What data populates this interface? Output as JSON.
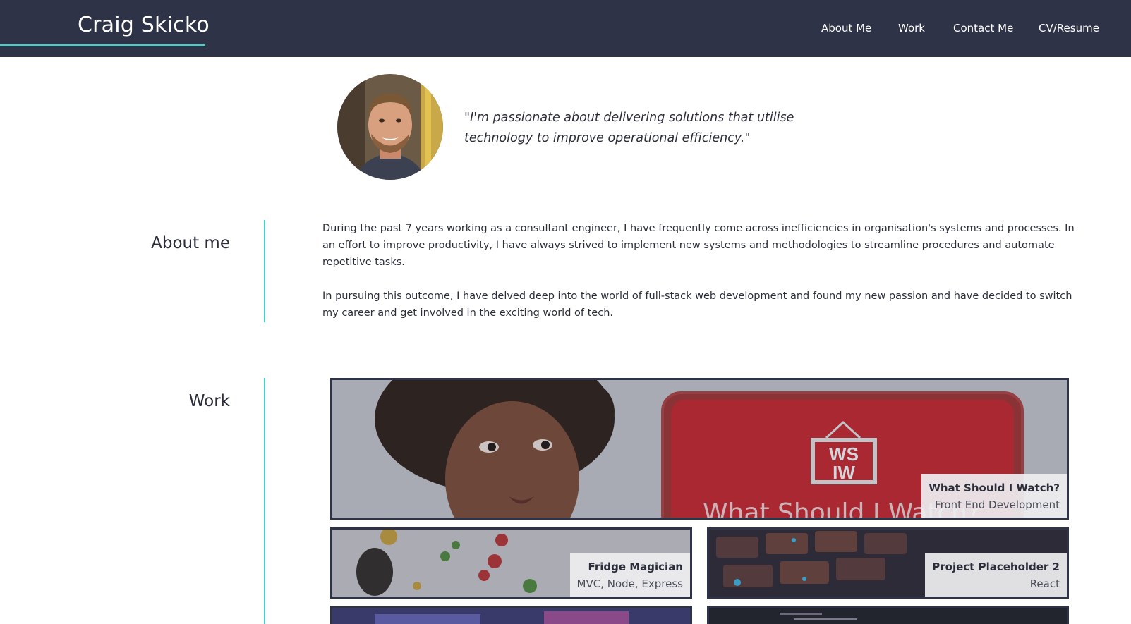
{
  "site": {
    "brand": "Craig Skicko"
  },
  "nav": {
    "items": [
      "About Me",
      "Work",
      "Contact Me",
      "CV/Resume"
    ]
  },
  "hero": {
    "quote": "\"I'm passionate about delivering solutions that utilise technology to improve operational efficiency.\""
  },
  "about": {
    "title": "About me",
    "paragraphs": [
      "During the past 7 years working as a consultant engineer, I have frequently come across inefficiencies in organisation's systems and processes. In an effort to improve productivity, I have always strived to implement new systems and methodologies to streamline procedures and automate repetitive tasks.",
      "In pursuing this outcome, I have delved deep into the world of full-stack web development and found my new passion and have decided to switch my career and get involved in the exciting world of tech."
    ]
  },
  "work": {
    "title": "Work",
    "projects": [
      {
        "title": "What Should I Watch?",
        "subtitle": "Front End Development",
        "logo_top": "WS",
        "logo_bottom": "IW",
        "banner": "What Should I Watch?"
      },
      {
        "title": "Fridge Magician",
        "subtitle": "MVC, Node, Express"
      },
      {
        "title": "Project Placeholder 2",
        "subtitle": "React"
      }
    ]
  },
  "colors": {
    "nav_bg": "#2e3347",
    "accent": "#3fd3c6",
    "text": "#2b2e3a"
  }
}
